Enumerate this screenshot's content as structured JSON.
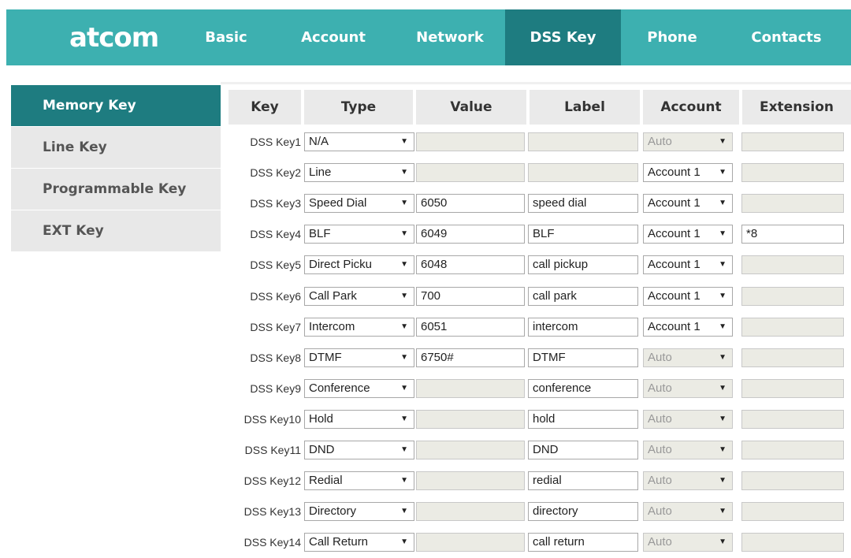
{
  "logo": "atcom",
  "nav": [
    "Basic",
    "Account",
    "Network",
    "DSS Key",
    "Phone",
    "Contacts"
  ],
  "sidebar": [
    "Memory Key",
    "Line Key",
    "Programmable Key",
    "EXT Key"
  ],
  "headers": [
    "Key",
    "Type",
    "Value",
    "Label",
    "Account",
    "Extension"
  ],
  "rows": [
    {
      "key": "DSS Key1",
      "type": "N/A",
      "value": "",
      "label": "",
      "account": "Auto",
      "extension": ""
    },
    {
      "key": "DSS Key2",
      "type": "Line",
      "value": "",
      "label": "",
      "account": "Account 1",
      "extension": ""
    },
    {
      "key": "DSS Key3",
      "type": "Speed Dial",
      "value": "6050",
      "label": "speed dial",
      "account": "Account 1",
      "extension": ""
    },
    {
      "key": "DSS Key4",
      "type": "BLF",
      "value": "6049",
      "label": "BLF",
      "account": "Account 1",
      "extension": "*8"
    },
    {
      "key": "DSS Key5",
      "type": "Direct Picku",
      "value": "6048",
      "label": "call pickup",
      "account": "Account 1",
      "extension": ""
    },
    {
      "key": "DSS Key6",
      "type": "Call Park",
      "value": "700",
      "label": "call park",
      "account": "Account 1",
      "extension": ""
    },
    {
      "key": "DSS Key7",
      "type": "Intercom",
      "value": "6051",
      "label": "intercom",
      "account": "Account 1",
      "extension": ""
    },
    {
      "key": "DSS Key8",
      "type": "DTMF",
      "value": "6750#",
      "label": "DTMF",
      "account": "Auto",
      "extension": ""
    },
    {
      "key": "DSS Key9",
      "type": "Conference",
      "value": "",
      "label": "conference",
      "account": "Auto",
      "extension": ""
    },
    {
      "key": "DSS Key10",
      "type": "Hold",
      "value": "",
      "label": "hold",
      "account": "Auto",
      "extension": ""
    },
    {
      "key": "DSS Key11",
      "type": "DND",
      "value": "",
      "label": "DND",
      "account": "Auto",
      "extension": ""
    },
    {
      "key": "DSS Key12",
      "type": "Redial",
      "value": "",
      "label": "redial",
      "account": "Auto",
      "extension": ""
    },
    {
      "key": "DSS Key13",
      "type": "Directory",
      "value": "",
      "label": "directory",
      "account": "Auto",
      "extension": ""
    },
    {
      "key": "DSS Key14",
      "type": "Call Return",
      "value": "",
      "label": "call return",
      "account": "Auto",
      "extension": ""
    }
  ],
  "state": {
    "value_disabled": [
      true,
      true,
      false,
      false,
      false,
      false,
      false,
      false,
      true,
      true,
      true,
      true,
      true,
      true
    ],
    "label_disabled": [
      true,
      true,
      false,
      false,
      false,
      false,
      false,
      false,
      false,
      false,
      false,
      false,
      false,
      false
    ],
    "account_disabled": [
      true,
      false,
      false,
      false,
      false,
      false,
      false,
      true,
      true,
      true,
      true,
      true,
      true,
      true
    ],
    "extension_disabled": [
      true,
      true,
      true,
      false,
      true,
      true,
      true,
      true,
      true,
      true,
      true,
      true,
      true,
      true
    ]
  },
  "colors": {
    "brand": "#3db0b0",
    "active": "#1e7c80",
    "header_bg": "#eaeaea",
    "disabled_bg": "#ebebe4"
  }
}
